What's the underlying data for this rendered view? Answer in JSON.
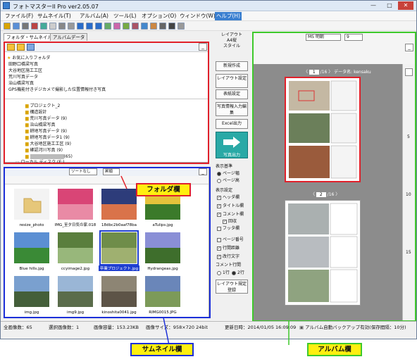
{
  "window": {
    "title": "フォトマスターII Pro ver2.05.07",
    "minimize": "—",
    "maximize": "□",
    "close": "✕"
  },
  "menu": [
    "ファイル(F)",
    "サムネイル(T)",
    "アルバム(A)",
    "ツール(L)",
    "オプション(O)",
    "ウィンドウ(W)",
    "ヘルプ(H)"
  ],
  "left_tabs": [
    "フォルダ・サムネイル",
    "アルバムデータ"
  ],
  "folder_panel": {
    "favorites_title": "お気に入りフォルダ",
    "favorites": [
      "田野口橋梁写真",
      "大谷地区施工工区",
      "荒川写真データ",
      "治山橋梁写真",
      "GPS機能付きデジカメで撮影した位置情報付き写真"
    ],
    "tree": [
      "プロジェクト_2",
      "構造設計",
      "荒川写真データ (9)",
      "治山橋梁写真",
      "耕地写真データ (9)",
      "耕地写真データ1 (9)",
      "大谷地区施工工区 (9)",
      "確認河川写真 (9)",
      "(65)"
    ],
    "tree_bottom": "ローカル ディスク (E:)"
  },
  "thumb_toolbar": {
    "sort_label": "ソートなし",
    "sort2_label": "昇順"
  },
  "thumbnails": [
    {
      "name": "resize_photo",
      "kind": "folder"
    },
    {
      "name": "IMG_至夕日気の家.018",
      "kind": "flowers"
    },
    {
      "name": "18dbc2b0aaf78ba",
      "kind": "sunset"
    },
    {
      "name": "aTulips.jpg",
      "kind": "tulips"
    },
    {
      "name": "Blue hills.jpg",
      "kind": "hills"
    },
    {
      "name": "ccyimage2.jpg",
      "kind": "forest"
    },
    {
      "name": "卒業プロジェクト.jpg",
      "kind": "aerial",
      "selected": true
    },
    {
      "name": "Hydrangeas.jpg",
      "kind": "hydrangea"
    },
    {
      "name": "img.jpg",
      "kind": "mountain"
    },
    {
      "name": "img9.jpg",
      "kind": "mountain2"
    },
    {
      "name": "kinoshita0041.jpg",
      "kind": "road"
    },
    {
      "name": "RIMG0015.JPG",
      "kind": "field"
    }
  ],
  "album_toolbar": {
    "layout_label": "レイアウト",
    "paper_label": "A4縦",
    "style_label": "スタイル",
    "font": "MS 明朝",
    "size": "9"
  },
  "side_buttons": [
    "新規作成",
    "レイアウト設定",
    "表紙設定",
    "写真情報入力編集",
    "Excel出力"
  ],
  "export_button": "写真出力",
  "display_base": {
    "title": "表示基準",
    "options": [
      "ページ幅",
      "ページ高"
    ],
    "selected": 0
  },
  "display_settings": {
    "title": "表示設定",
    "items": [
      {
        "label": "ヘッダ欄",
        "checked": true
      },
      {
        "label": "タイトル欄",
        "checked": true
      },
      {
        "label": "コメント欄",
        "checked": true
      },
      {
        "label": "回収",
        "checked": true
      },
      {
        "label": "フッタ欄",
        "checked": false
      },
      {
        "label": "ページ番号",
        "checked": false
      },
      {
        "label": "行間距離",
        "checked": true
      },
      {
        "label": "改行文字",
        "checked": true
      }
    ]
  },
  "comment_lines": {
    "title": "コメント行間",
    "options": [
      "1行",
      "2行"
    ],
    "selected": 1
  },
  "layout_register_button": "レイアウト規定登録",
  "album": {
    "page1": "1",
    "page2": "2",
    "total": "/16",
    "data_name": "データ名: kensaku"
  },
  "ruler_numbers": [
    "5",
    "10",
    "15"
  ],
  "status": {
    "total": "全画像数：65",
    "selected": "選択画像数：1",
    "size": "画像容量：153.23KB",
    "dims": "画像サイズ：958×720 24bit",
    "updated": "更新日時：2014/01/05 16:09:09",
    "backup": "アルバム自動バックアップ有効(保存間隔：10分)"
  },
  "callouts": {
    "folder": "フォルダ欄",
    "thumbnail": "サムネイル欄",
    "album": "アルバム欄"
  },
  "colors": {
    "folder_frame": "#e0202a",
    "thumbnail_frame": "#1c2fd8",
    "album_frame": "#3ec92b",
    "callout_yellow": "#ffef10"
  }
}
